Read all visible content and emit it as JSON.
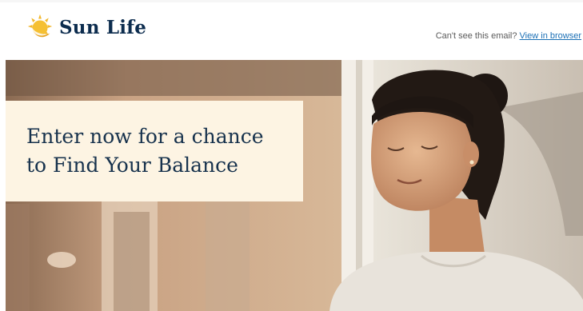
{
  "brand": {
    "name": "Sun Life",
    "logo_icon": "sun-icon",
    "accent": "#f2b72b",
    "navy": "#0c2c4e"
  },
  "header": {
    "cant_see_text": "Can't see this email?",
    "view_link": "View in browser"
  },
  "hero": {
    "headline": "Enter now for a chance\nto Find Your Balance",
    "box_color": "#fdf4e3"
  }
}
